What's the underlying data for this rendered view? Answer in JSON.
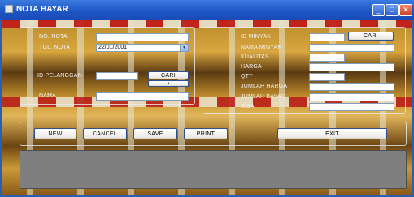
{
  "window": {
    "title": "NOTA BAYAR",
    "minimize_glyph": "_",
    "maximize_glyph": "□",
    "close_glyph": "✕"
  },
  "left_form": {
    "no_nota_label": "NO. NOTA",
    "no_nota_value": "",
    "tgl_nota_label": "TGL. NOTA",
    "tgl_nota_value": "22/01/2001",
    "combo_arrow": "▾",
    "id_pelanggan_label": "ID PELANGGAN",
    "id_pelanggan_value": "",
    "cari_label": "CARI",
    "small_btn_label": "•",
    "nama_label": "NAMA",
    "nama_value": ""
  },
  "right_form": {
    "id_minyak_label": "ID MINYAK",
    "id_minyak_value": "",
    "cari_label": "CARI",
    "nama_minyak_label": "NAMA MINYAK",
    "nama_minyak_value": "",
    "kualitas_label": "KUALITAS",
    "kualitas_value": "",
    "harga_label": "HARGA",
    "harga_value": "",
    "qty_label": "QTY",
    "qty_value": "",
    "jumlah_harga_label": "JUMLAH HARGA",
    "jumlah_harga_value": "",
    "jumlah_bayar_label": "JUMLAH BAYAR",
    "jumlah_bayar_value": "",
    "sisa_label": "SISA",
    "sisa_value": ""
  },
  "actions": {
    "new": "NEW",
    "cancel": "CANCEL",
    "save": "SAVE",
    "print": "PRINT",
    "exit": "EXIT"
  }
}
